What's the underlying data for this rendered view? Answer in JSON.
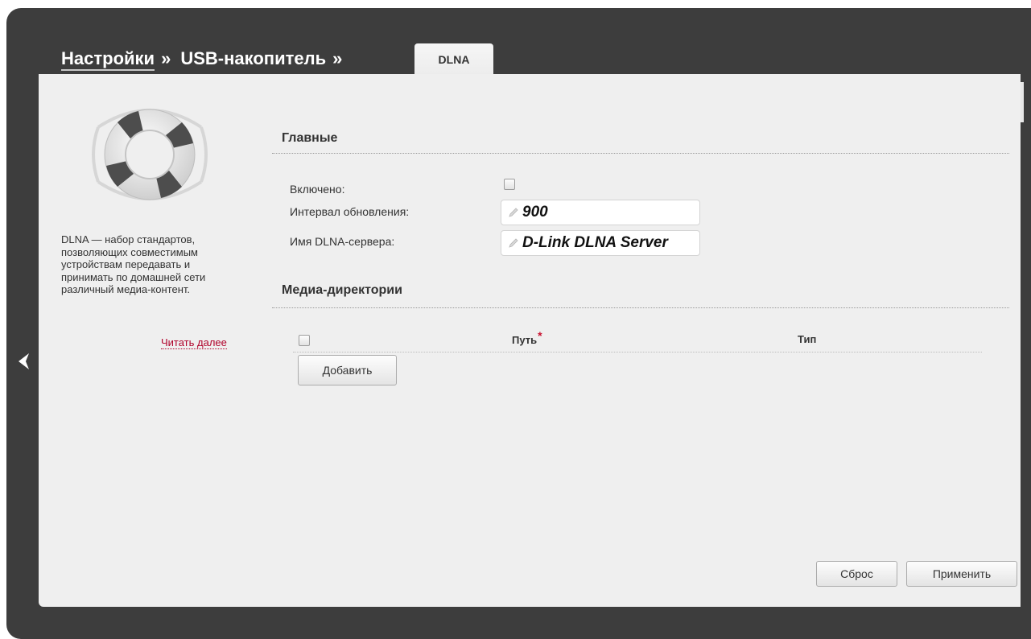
{
  "breadcrumb": {
    "settings": "Настройки",
    "sep1": "»",
    "usb": "USB-накопитель",
    "sep2": "»"
  },
  "tab": {
    "label": "DLNA"
  },
  "help": {
    "text": "DLNA — набор стандартов, позволяющих совместимым устройствам передавать и принимать по домашней сети различный медиа-контент.",
    "read_more": "Читать далее",
    "icon": "lifebuoy-icon"
  },
  "main_section": {
    "title": "Главные",
    "enabled_label": "Включено:",
    "enabled_checked": false,
    "interval_label": "Интервал обновления:",
    "interval_value": "900",
    "server_name_label": "Имя DLNA-сервера:",
    "server_name_value": "D-Link DLNA Server"
  },
  "media_section": {
    "title": "Медиа-директории",
    "columns": {
      "path": "Путь",
      "type": "Тип",
      "required_mark": "*"
    },
    "add_button": "Добавить"
  },
  "footer": {
    "reset_button": "Сброс",
    "apply_button": "Применить"
  },
  "nav": {
    "back_icon": "chevron-left-icon"
  },
  "colors": {
    "frame": "#3d3d3d",
    "panel": "#efefef",
    "link_red": "#b0002a"
  }
}
